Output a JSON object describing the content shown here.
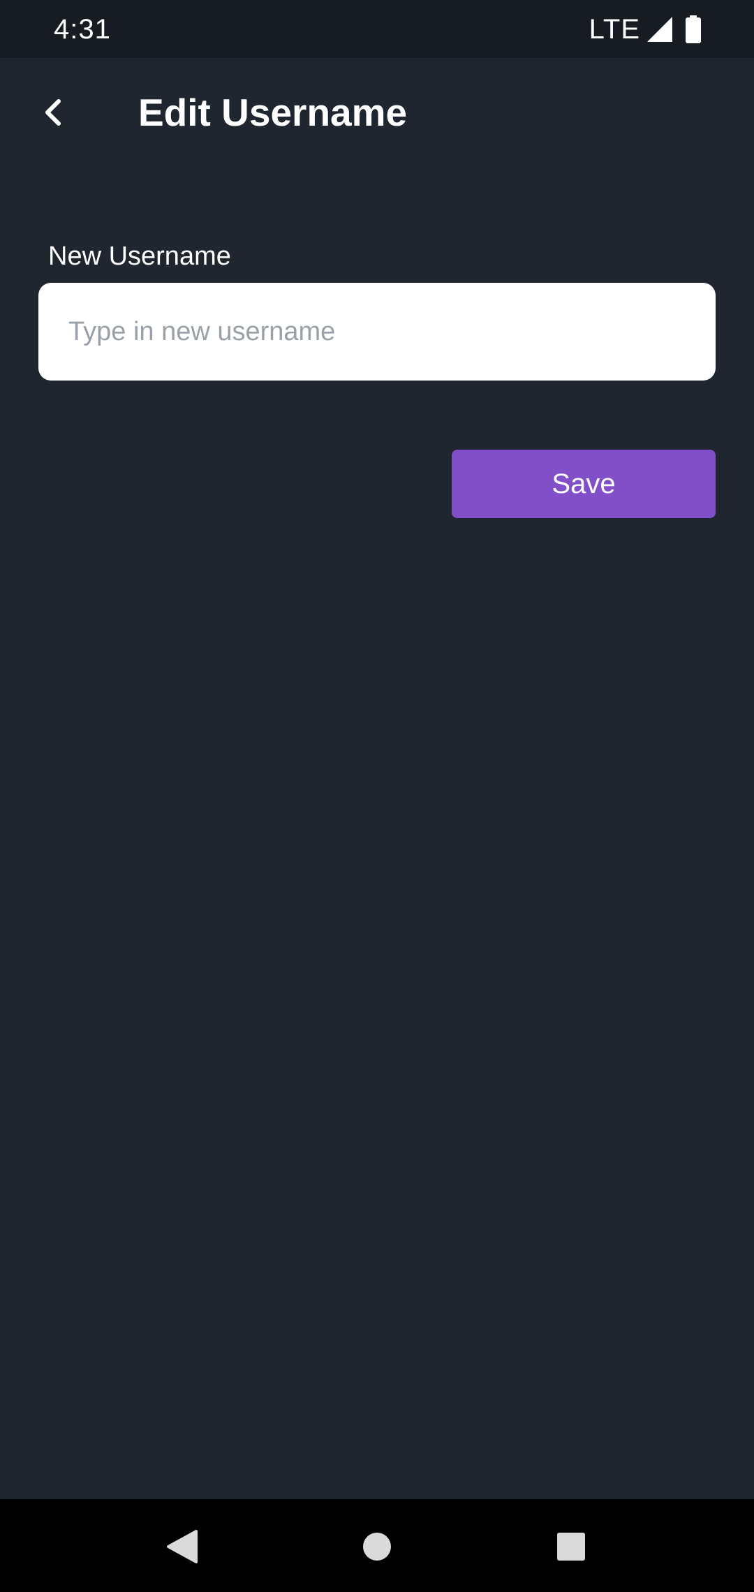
{
  "status_bar": {
    "time": "4:31",
    "network": "LTE",
    "signal_icon": "signal-full-icon",
    "battery_icon": "battery-full-icon"
  },
  "app_bar": {
    "back_icon": "chevron-left-icon",
    "title": "Edit Username"
  },
  "form": {
    "label": "New Username",
    "input_value": "",
    "input_placeholder": "Type in new username",
    "save_label": "Save"
  },
  "nav_bar": {
    "back_icon": "triangle-back-icon",
    "home_icon": "circle-home-icon",
    "recents_icon": "square-recents-icon"
  },
  "colors": {
    "background": "#20262f",
    "status_bar": "#171c23",
    "accent": "#8150c8",
    "input_bg": "#ffffff",
    "placeholder": "#9aa0a8",
    "nav_bar": "#000000"
  }
}
